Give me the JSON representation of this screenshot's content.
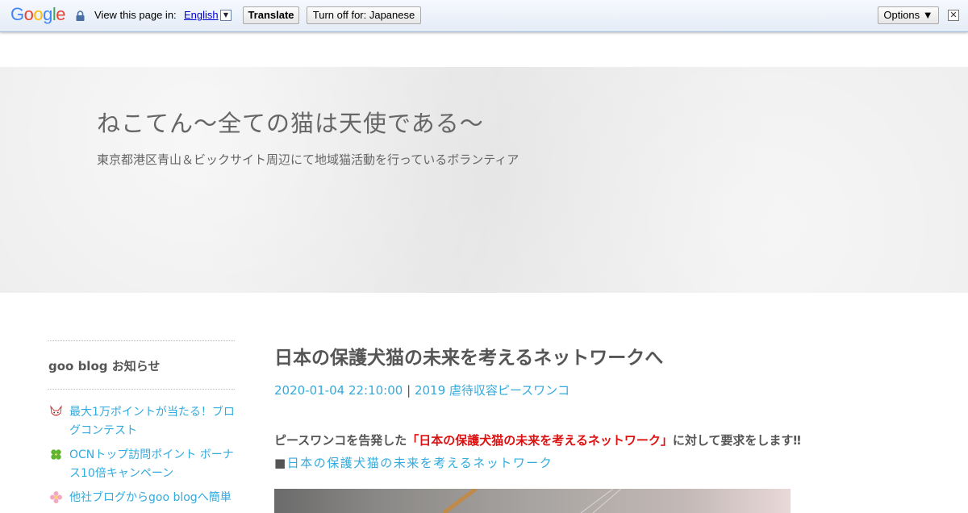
{
  "translate_bar": {
    "logo": "Google",
    "prompt": "View this page in:",
    "language": "English",
    "translate_label": "Translate",
    "turn_off_label": "Turn off for: Japanese",
    "options_label": "Options ▼",
    "close_label": "✕"
  },
  "header": {
    "title": "ねこてん～全ての猫は天使である～",
    "description": "東京都港区青山＆ビックサイト周辺にて地域猫活動を行っているボランティア"
  },
  "sidebar": {
    "heading": "goo blog お知らせ",
    "items": [
      {
        "label": "最大1万ポイントが当たる！ブログコンテスト",
        "icon": "fox-icon"
      },
      {
        "label": "OCNトップ訪問ポイント ボーナス10倍キャンペーン",
        "icon": "clover-icon"
      },
      {
        "label": "他社ブログからgoo blogへ簡単",
        "icon": "flower-icon"
      }
    ]
  },
  "post": {
    "title": "日本の保護犬猫の未来を考えるネットワークへ",
    "date": "2020-01-04 22:10:00",
    "separator": "|",
    "category": "2019 虐待収容ピースワンコ",
    "lead_before": "ピースワンコを告発した",
    "lead_highlight": "「日本の保護犬猫の未来を考えるネットワーク」",
    "lead_after": "に対して要求をします‼",
    "bullet": "■",
    "link_text": "日本の保護犬猫の未来を考えるネットワーク"
  },
  "colors": {
    "accent": "#33aadd",
    "highlight": "#dd1111",
    "text": "#555555"
  }
}
